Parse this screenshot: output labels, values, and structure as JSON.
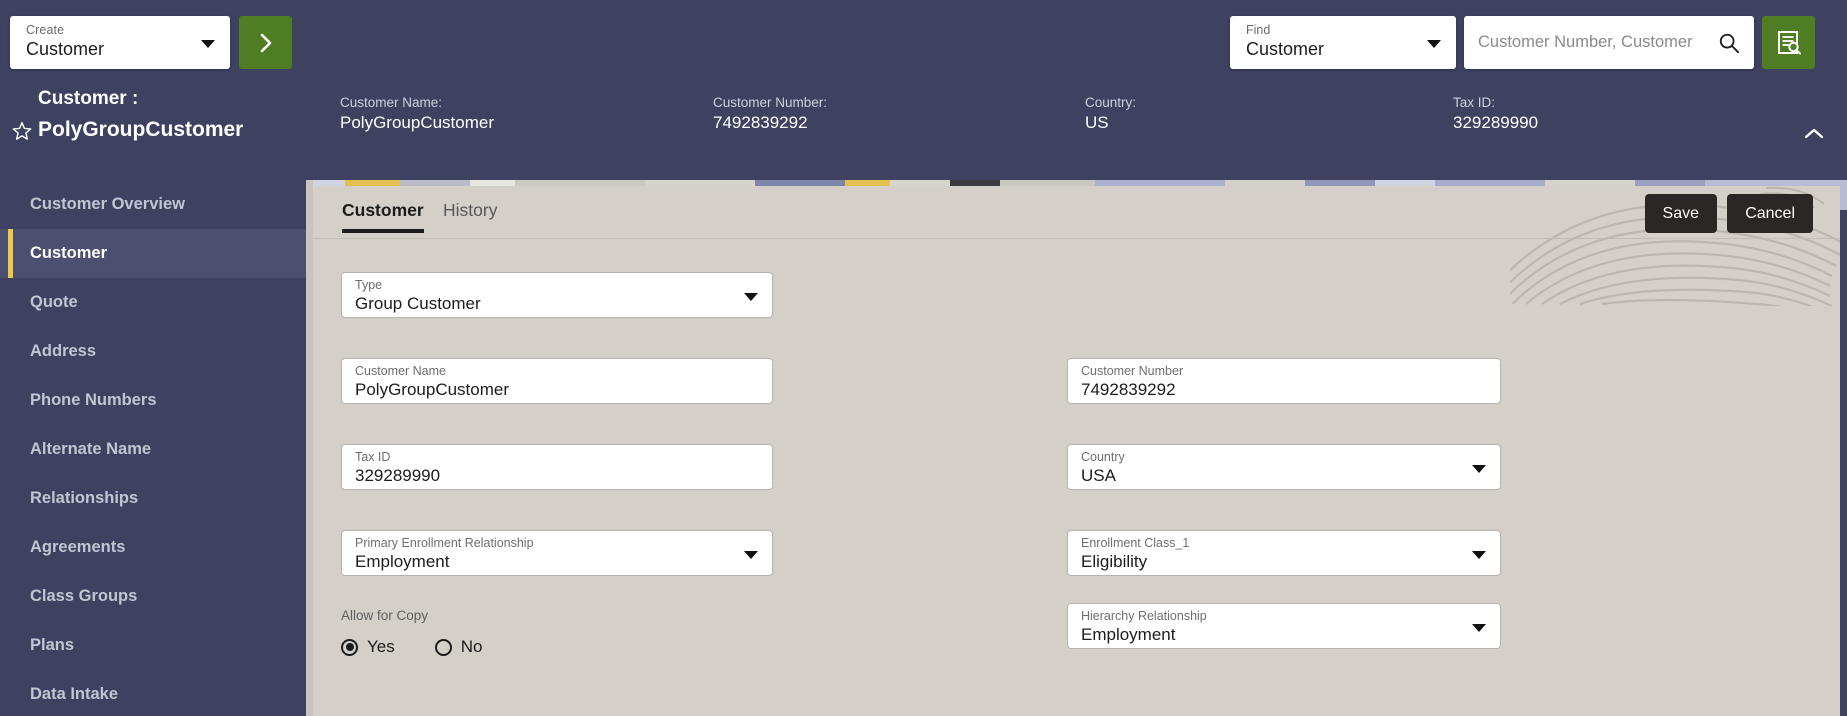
{
  "topbar": {
    "create": {
      "label": "Create",
      "value": "Customer"
    },
    "go_button": {
      "icon": "chevron-right-icon"
    },
    "find": {
      "label": "Find",
      "value": "Customer"
    },
    "search": {
      "placeholder": "Customer Number, Customer",
      "value": "",
      "icon": "search-icon"
    },
    "grid_button": {
      "icon": "list-search-icon"
    }
  },
  "record_header": {
    "title_prefix": "Customer :",
    "title": "PolyGroupCustomer",
    "favorite_icon": "star-outline-icon",
    "collapse_icon": "chevron-up-icon",
    "summary": [
      {
        "label": "Customer Name:",
        "value": "PolyGroupCustomer"
      },
      {
        "label": "Customer Number:",
        "value": "7492839292"
      },
      {
        "label": "Country:",
        "value": "US"
      },
      {
        "label": "Tax ID:",
        "value": "329289990"
      }
    ]
  },
  "sidebar": {
    "items": [
      {
        "label": "Customer Overview",
        "active": false
      },
      {
        "label": "Customer",
        "active": true
      },
      {
        "label": "Quote",
        "active": false
      },
      {
        "label": "Address",
        "active": false
      },
      {
        "label": "Phone Numbers",
        "active": false
      },
      {
        "label": "Alternate Name",
        "active": false
      },
      {
        "label": "Relationships",
        "active": false
      },
      {
        "label": "Agreements",
        "active": false
      },
      {
        "label": "Class Groups",
        "active": false
      },
      {
        "label": "Plans",
        "active": false
      },
      {
        "label": "Data Intake",
        "active": false
      }
    ]
  },
  "content": {
    "tabs": [
      {
        "label": "Customer",
        "active": true
      },
      {
        "label": "History",
        "active": false
      }
    ],
    "actions": {
      "save_label": "Save",
      "cancel_label": "Cancel"
    },
    "fields": {
      "type": {
        "label": "Type",
        "value": "Group Customer"
      },
      "customer_name": {
        "label": "Customer Name",
        "value": "PolyGroupCustomer"
      },
      "customer_number": {
        "label": "Customer Number",
        "value": "7492839292"
      },
      "tax_id": {
        "label": "Tax ID",
        "value": "329289990"
      },
      "country": {
        "label": "Country",
        "value": "USA"
      },
      "primary_enrollment_relationship": {
        "label": "Primary Enrollment Relationship",
        "value": "Employment"
      },
      "enrollment_class_1": {
        "label": "Enrollment Class_1",
        "value": "Eligibility"
      },
      "hierarchy_relationship": {
        "label": "Hierarchy Relationship",
        "value": "Employment"
      }
    },
    "allow_for_copy": {
      "label": "Allow for Copy",
      "yes_label": "Yes",
      "no_label": "No",
      "selected": "Yes"
    }
  },
  "colors": {
    "nav_background": "#3e4260",
    "nav_active_background": "#4b5070",
    "nav_active_accent": "#edc84b",
    "accent_green": "#4e7d23",
    "content_background": "#d4cfc9",
    "action_button": "#2b2724"
  }
}
